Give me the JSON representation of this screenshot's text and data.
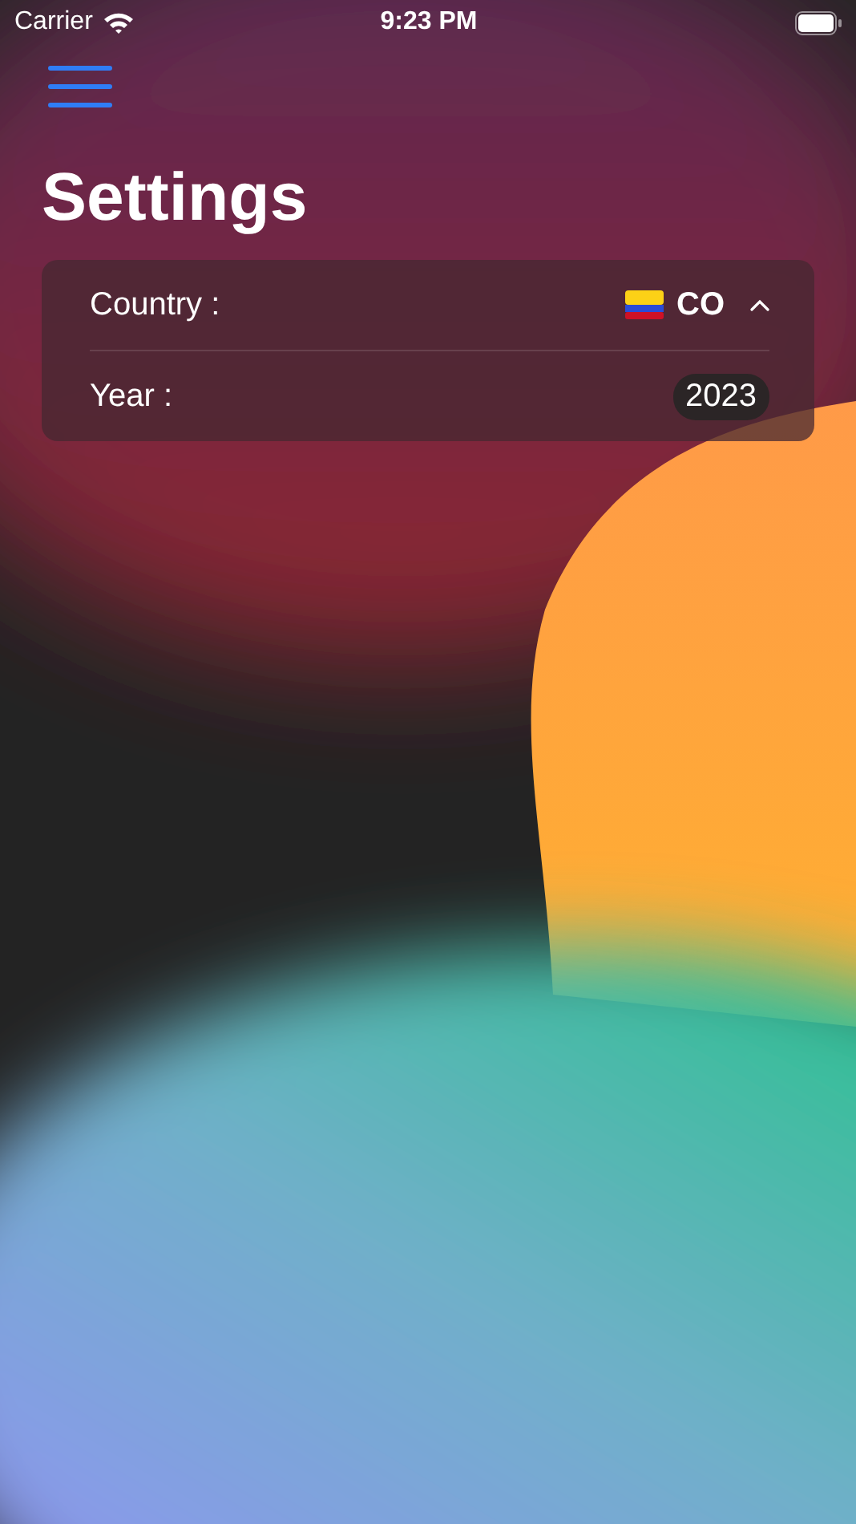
{
  "status_bar": {
    "carrier": "Carrier",
    "time": "9:23 PM"
  },
  "title": "Settings",
  "settings": [
    {
      "kind": "dropdown",
      "label": "Country :",
      "value": "CO",
      "expanded": true
    },
    {
      "kind": "pill",
      "label": "Year :",
      "value": "2023"
    }
  ]
}
